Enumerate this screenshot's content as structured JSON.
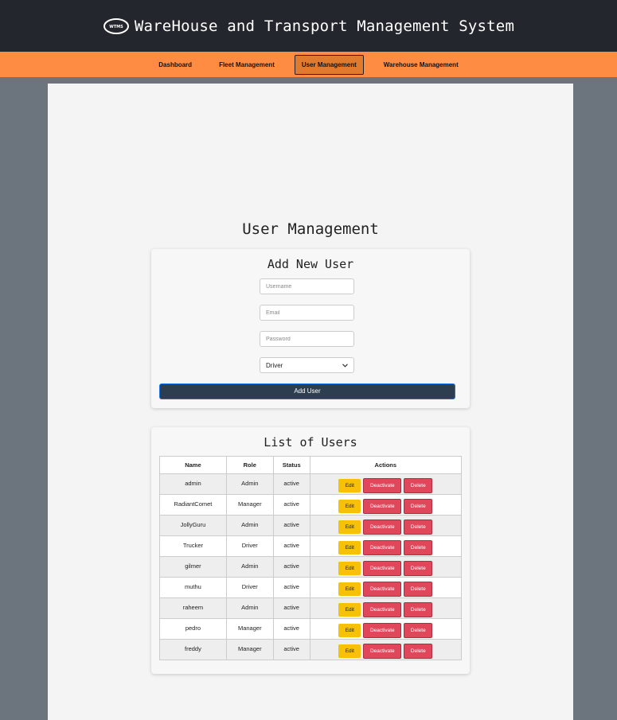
{
  "header": {
    "title": "WareHouse and Transport Management System",
    "logo_icon": "wtms-logo-icon"
  },
  "nav": {
    "items": [
      {
        "label": "Dashboard",
        "active": false
      },
      {
        "label": "Fleet Management",
        "active": false
      },
      {
        "label": "User Management",
        "active": true
      },
      {
        "label": "Warehouse Management",
        "active": false
      }
    ]
  },
  "main": {
    "page_title": "User Management"
  },
  "add_user": {
    "title": "Add New User",
    "username_placeholder": "Username",
    "email_placeholder": "Email",
    "password_placeholder": "Password",
    "role_selected": "Driver",
    "submit_label": "Add User"
  },
  "user_list": {
    "title": "List of Users",
    "columns": [
      "Name",
      "Role",
      "Status",
      "Actions"
    ],
    "rows": [
      {
        "name": "admin",
        "role": "Admin",
        "status": "active"
      },
      {
        "name": "RadiantComet",
        "role": "Manager",
        "status": "active"
      },
      {
        "name": "JollyGuru",
        "role": "Admin",
        "status": "active"
      },
      {
        "name": "Trucker",
        "role": "Driver",
        "status": "active"
      },
      {
        "name": "gilmer",
        "role": "Admin",
        "status": "active"
      },
      {
        "name": "muthu",
        "role": "Driver",
        "status": "active"
      },
      {
        "name": "raheem",
        "role": "Admin",
        "status": "active"
      },
      {
        "name": "pedro",
        "role": "Manager",
        "status": "active"
      },
      {
        "name": "freddy",
        "role": "Manager",
        "status": "active"
      }
    ],
    "actions": {
      "edit": "Edit",
      "deactivate": "Deactivate",
      "delete": "Delete"
    }
  },
  "colors": {
    "header_bg": "#23272d",
    "nav_bg": "#ff8c42",
    "page_bg": "#6c757d",
    "primary_btn": "#2c3e50",
    "edit_btn": "#f6c107",
    "danger_btn": "#e0475b"
  }
}
